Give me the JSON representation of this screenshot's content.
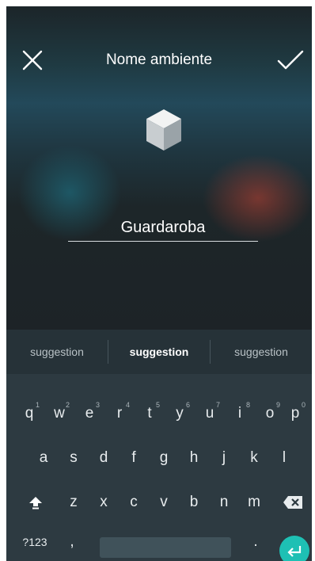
{
  "header": {
    "title": "Nome ambiente"
  },
  "room": {
    "name_value": "Guardaroba"
  },
  "keyboard": {
    "suggestions": [
      "suggestion",
      "suggestion",
      "suggestion"
    ],
    "row1": [
      {
        "key": "q",
        "hint": "1"
      },
      {
        "key": "w",
        "hint": "2"
      },
      {
        "key": "e",
        "hint": "3"
      },
      {
        "key": "r",
        "hint": "4"
      },
      {
        "key": "t",
        "hint": "5"
      },
      {
        "key": "y",
        "hint": "6"
      },
      {
        "key": "u",
        "hint": "7"
      },
      {
        "key": "i",
        "hint": "8"
      },
      {
        "key": "o",
        "hint": "9"
      },
      {
        "key": "p",
        "hint": "0"
      }
    ],
    "row2": [
      "a",
      "s",
      "d",
      "f",
      "g",
      "h",
      "j",
      "k",
      "l"
    ],
    "row3": [
      "z",
      "x",
      "c",
      "v",
      "b",
      "n",
      "m"
    ],
    "symbols_label": "?123",
    "comma_label": ",",
    "period_label": "."
  },
  "icons": {
    "close": "close-icon",
    "confirm": "check-icon",
    "room": "cube-icon",
    "shift": "shift-icon",
    "backspace": "backspace-icon",
    "enter": "enter-icon"
  },
  "colors": {
    "accent": "#1ec0b4",
    "keyboard_bg": "#2d3a41",
    "suggestion_bg": "#263238"
  }
}
